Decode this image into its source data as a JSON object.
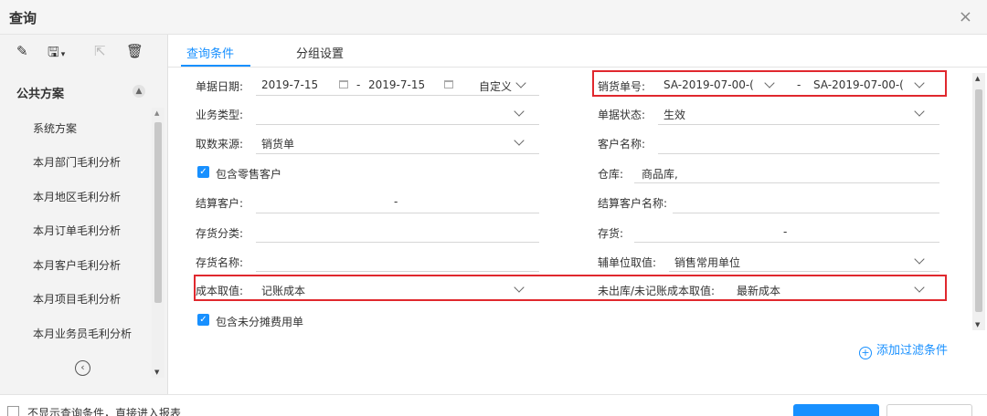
{
  "window": {
    "title": "查询",
    "close_glyph": "×"
  },
  "sidebar": {
    "toolbar": [
      {
        "icon": "pencil-icon",
        "glyph": "✎"
      },
      {
        "icon": "save-icon",
        "glyph": "🖫",
        "dropdown": true
      },
      {
        "icon": "export-icon",
        "glyph": "⇱",
        "disabled": true
      },
      {
        "icon": "trash-icon",
        "glyph": "🗑"
      }
    ],
    "section_title": "公共方案",
    "items": [
      "系统方案",
      "本月部门毛利分析",
      "本月地区毛利分析",
      "本月订单毛利分析",
      "本月客户毛利分析",
      "本月项目毛利分析",
      "本月业务员毛利分析"
    ]
  },
  "tabs": [
    {
      "label": "查询条件",
      "active": true
    },
    {
      "label": "分组设置",
      "active": false
    }
  ],
  "fields": {
    "date": {
      "label": "单据日期:",
      "from": "2019-7-15",
      "dash": "-",
      "to": "2019-7-15",
      "preset": "自定义"
    },
    "biz_type": {
      "label": "业务类型:",
      "value": ""
    },
    "source": {
      "label": "取数来源:",
      "value": "销货单"
    },
    "retail": {
      "label": "包含零售客户",
      "checked": true
    },
    "settle_customer": {
      "label": "结算客户:",
      "dash": "-"
    },
    "inv_category": {
      "label": "存货分类:",
      "value": ""
    },
    "inv_name": {
      "label": "存货名称:",
      "value": ""
    },
    "cost_value": {
      "label": "成本取值:",
      "value": "记账成本"
    },
    "unallocated": {
      "label": "包含未分摊费用单",
      "checked": true
    },
    "sales_no": {
      "label": "销货单号:",
      "from": "SA-2019-07-00-(",
      "dash": "-",
      "to": "SA-2019-07-00-("
    },
    "doc_status": {
      "label": "单据状态:",
      "value": "生效"
    },
    "customer_name": {
      "label": "客户名称:",
      "value": ""
    },
    "warehouse": {
      "label": "仓库:",
      "value": "商品库,"
    },
    "settle_customer_name": {
      "label": "结算客户名称:",
      "value": ""
    },
    "inventory": {
      "label": "存货:",
      "dash": "-"
    },
    "aux_unit": {
      "label": "辅单位取值:",
      "value": "销售常用单位"
    },
    "unposted_cost": {
      "label": "未出库/未记账成本取值:",
      "value": "最新成本"
    }
  },
  "add_filter": {
    "plus": "+",
    "label": "添加过滤条件"
  },
  "footer": {
    "skip_label": "不显示查询条件，直接进入报表"
  },
  "colors": {
    "accent": "#1890ff",
    "highlight": "#e0282e"
  }
}
